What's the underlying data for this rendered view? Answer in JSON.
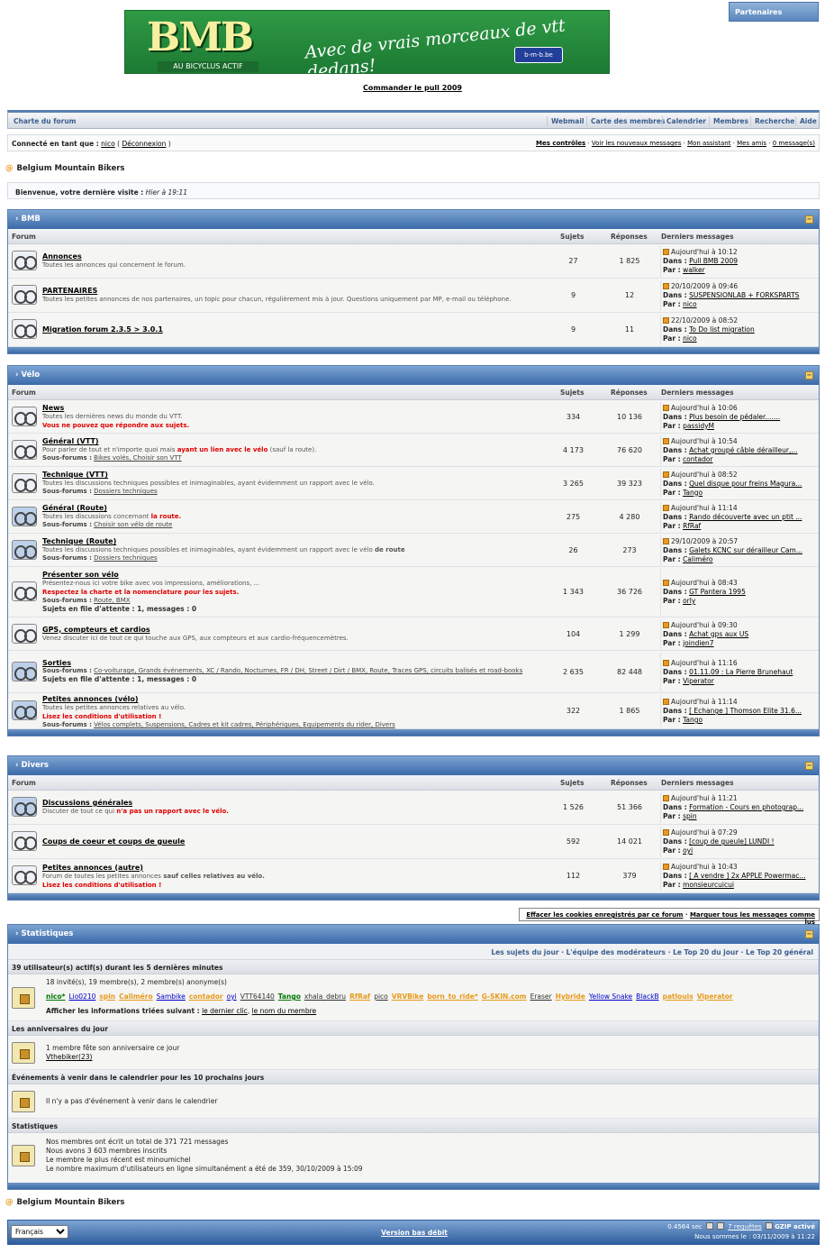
{
  "banner": {
    "logo": "BMB",
    "logo_sub": "AU BICYCLUS ACTIF",
    "slogan": "Avec de vrais morceaux de vtt dedans!",
    "site": "b-m-b.be"
  },
  "partners": "Partenaires",
  "pull_link": "Commander le pull 2009",
  "nav": {
    "charter": "Charte du forum",
    "webmail": "Webmail",
    "map": "Carte des membres",
    "calendar": "Calendrier",
    "members": "Membres",
    "search": "Recherche",
    "help": "Aide"
  },
  "user": {
    "connected": "Connecté en tant que :",
    "name": "nico",
    "logout": "Déconnexion",
    "controls": "Mes contrôles",
    "new_msgs": "Voir les nouveaux messages",
    "assistant": "Mon assistant",
    "friends": "Mes amis",
    "pm": "0 message(s)"
  },
  "crumb": "Belgium Mountain Bikers",
  "welcome": {
    "text": "Bienvenue, votre dernière visite :",
    "when": "Hier à 19:11"
  },
  "columns": {
    "forum": "Forum",
    "topics": "Sujets",
    "replies": "Réponses",
    "last": "Derniers messages"
  },
  "labels": {
    "in": "Dans :",
    "by": "Par :",
    "subforums": "Sous-forums :",
    "queue": "Sujets en file d'attente : 1, messages : 0"
  },
  "categories": [
    {
      "name": "BMB",
      "forums": [
        {
          "title": "Annonces",
          "desc": "Toutes les annonces qui concernent le forum.",
          "topics": "27",
          "replies": "1 825",
          "date": "Aujourd'hui à 10:12",
          "in": "Pull BMB 2009",
          "by": "walker"
        },
        {
          "title": "PARTENAIRES",
          "desc": "Toutes les petites annonces de nos partenaires, un topic pour chacun, régulièrement mis à jour. Questions uniquement par MP, e-mail ou téléphone.",
          "topics": "9",
          "replies": "12",
          "date": "20/10/2009 à 09:46",
          "in": "SUSPENSIONLAB + FORKSPARTS",
          "by": "nico"
        },
        {
          "title": "Migration forum 2.3.5 > 3.0.1",
          "desc": "",
          "topics": "9",
          "replies": "11",
          "date": "22/10/2009 à 08:52",
          "in": "To Do list migration",
          "by": "nico"
        }
      ]
    },
    {
      "name": "Vélo",
      "forums": [
        {
          "title": "News",
          "desc": "Toutes les dernières news du monde du VTT.",
          "red": "Vous ne pouvez que répondre aux sujets.",
          "topics": "334",
          "replies": "10 136",
          "date": "Aujourd'hui à 10:06",
          "in": "Plus besoin de pédaler.......",
          "by": "passidyM"
        },
        {
          "title": "Général (VTT)",
          "desc": "Pour parler de tout et n'importe quoi mais",
          "desc_red": "ayant un lien avec le vélo",
          "desc2": "(sauf la route).",
          "sub": "Bikes volés, Choisir son VTT",
          "topics": "4 173",
          "replies": "76 620",
          "date": "Aujourd'hui à 10:54",
          "in": "Achat groupé câble dérailleur,...",
          "by": "contador"
        },
        {
          "title": "Technique (VTT)",
          "desc": "Toutes les discussions techniques possibles et inimaginables, ayant évidemment un rapport avec le vélo.",
          "sub": "Dossiers techniques",
          "topics": "3 265",
          "replies": "39 323",
          "date": "Aujourd'hui à 08:52",
          "in": "Quel disque pour freins Magura...",
          "by": "Tango"
        },
        {
          "title": "Général (Route)",
          "desc": "Toutes les discussions concernant",
          "desc_red": "la route.",
          "sub": "Choisir son vélo de route",
          "topics": "275",
          "replies": "4 280",
          "date": "Aujourd'hui à 11:14",
          "in": "Rando découverte avec un ptit ...",
          "by": "RfRaf"
        },
        {
          "title": "Technique (Route)",
          "desc": "Toutes les discussions techniques possibles et inimaginables, ayant évidemment un rapport avec le vélo",
          "desc_b": "de route",
          "sub": "Dossiers techniques",
          "topics": "26",
          "replies": "273",
          "date": "29/10/2009 à 20:57",
          "in": "Galets KCNC sur dérailleur Cam...",
          "by": "Caliméro"
        },
        {
          "title": "Présenter son vélo",
          "desc": "Présentez-nous ici votre bike avec vos impressions, améliorations, ...",
          "red": "Respectez la charte et la nomenclature pour les sujets.",
          "sub": "Route, BMX",
          "queue": true,
          "topics": "1 343",
          "replies": "36 726",
          "date": "Aujourd'hui à 08:43",
          "in": "GT Pantera 1995",
          "by": "orly"
        },
        {
          "title": "GPS, compteurs et cardios",
          "desc": "Venez discuter ici de tout ce qui touche aux GPS, aux compteurs et aux cardio-fréquencemètres.",
          "topics": "104",
          "replies": "1 299",
          "date": "Aujourd'hui à 09:30",
          "in": "Achat gps aux US",
          "by": "joindien7"
        },
        {
          "title": "Sorties",
          "desc": "",
          "sub": "Co-voiturage, Grands événements, XC / Rando, Nocturnes, FR / DH, Street / Dirt / BMX, Route, Traces GPS, circuits balisés et road-books",
          "queue": true,
          "topics": "2 635",
          "replies": "82 448",
          "date": "Aujourd'hui à 11:16",
          "in": "01.11.09 : La Pierre Brunehaut",
          "by": "Viperator"
        },
        {
          "title": "Petites annonces (vélo)",
          "desc": "Toutes les petites annonces relatives au vélo.",
          "red": "Lisez les conditions d'utilisation !",
          "sub": "Vélos complets, Suspensions, Cadres et kit cadres, Périphériques, Equipements du rider, Divers",
          "topics": "322",
          "replies": "1 865",
          "date": "Aujourd'hui à 11:14",
          "in": "[ Echange ] Thomson Elite 31.6...",
          "by": "Tango"
        }
      ]
    },
    {
      "name": "Divers",
      "forums": [
        {
          "title": "Discussions générales",
          "desc": "Discuter de tout ce qui",
          "desc_red": "n'a pas un rapport avec le vélo.",
          "topics": "1 526",
          "replies": "51 366",
          "date": "Aujourd'hui à 11:21",
          "in": "Formation - Cours en photograp...",
          "by": "spin"
        },
        {
          "title": "Coups de coeur et coups de gueule",
          "desc": "",
          "topics": "592",
          "replies": "14 021",
          "date": "Aujourd'hui à 07:29",
          "in": "[coup de gueule] LUNDI !",
          "by": "oyi"
        },
        {
          "title": "Petites annonces (autre)",
          "desc": "Forum de toutes les petites annonces",
          "desc_b": "sauf celles relatives au vélo.",
          "red": "Lisez les conditions d'utilisation !",
          "topics": "112",
          "replies": "379",
          "date": "Aujourd'hui à 10:43",
          "in": "[ A vendre ] 2x APPLE Powermac...",
          "by": "monsieurcuicui"
        }
      ]
    }
  ],
  "actions": {
    "cookies": "Effacer les cookies enregistrés par ce forum",
    "mark": "Marquer tous les messages comme lus"
  },
  "stats": {
    "title": "Statistiques",
    "links": "Les sujets du jour · L'équipe des modérateurs · Le Top 20 du jour · Le Top 20 général",
    "active_head": "39 utilisateur(s) actif(s) durant les 5 dernières minutes",
    "active_counts": "18 invité(s), 19 membre(s), 2 membre(s) anonyme(s)",
    "users": [
      "nico*",
      "Lio0210",
      "spin",
      "Caliméro",
      "Sambike",
      "contador",
      "oyi",
      "VTT64140",
      "Tango",
      "xhala_debru",
      "RfRaf",
      "pico",
      "VRVBike",
      "born_to_ride*",
      "G-SKIN.com",
      "Eraser",
      "Hybride",
      "Yellow Snake",
      "BlackB",
      "patlouis",
      "Viperator"
    ],
    "sort": "Afficher les informations triées suivant :",
    "sort1": "le dernier clic",
    "sort2": "le nom du membre",
    "bday_head": "Les anniversaires du jour",
    "bday_text": "1 membre fête son anniversaire ce jour",
    "bday_user": "Vthebiker(23)",
    "events_head": "Événements à venir dans le calendrier pour les 10 prochains jours",
    "events_text": "Il n'y a pas d'événement à venir dans le calendrier",
    "stats_head": "Statistiques",
    "s1": "Nos membres ont écrit un total de 371 721 messages",
    "s2": "Nous avons 3 603 membres inscrits",
    "s3": "Le membre le plus récent est minoumichel",
    "s4": "Le nombre maximum d'utilisateurs en ligne simultanément a été de 359, 30/10/2009 à 15:09"
  },
  "crumb2": "Belgium Mountain Bikers",
  "footer": {
    "lang": "Français",
    "low": "Version bas débit",
    "time": "0.4564 sec",
    "req": "7 requêtes",
    "gzip": "GZIP activé",
    "now": "Nous sommes le : 03/11/2009 à 11:22"
  },
  "colors": {
    "accent": "#3a6aa8",
    "banner": "#2f9a45",
    "red": "#dd0000"
  }
}
